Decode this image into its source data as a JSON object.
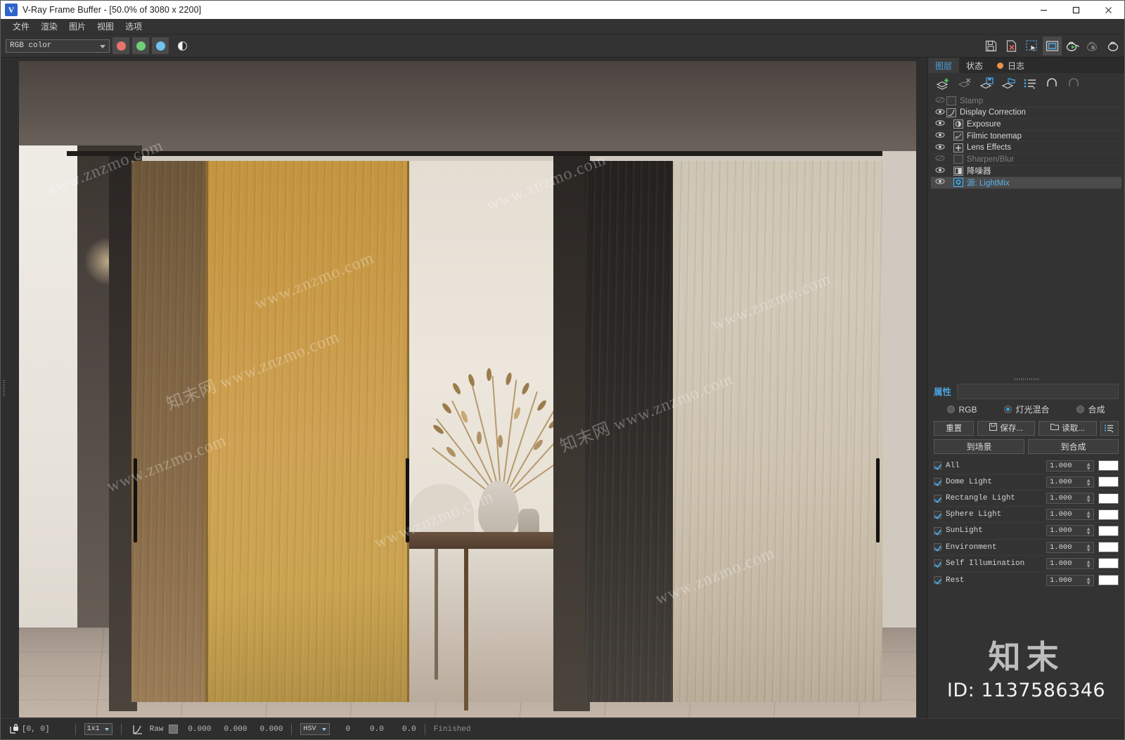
{
  "window": {
    "title": "V-Ray Frame Buffer - [50.0% of 3080 x 2200]",
    "app_icon": "vray-logo-icon",
    "minimize": "minimize-icon",
    "maximize": "maximize-icon",
    "close": "close-icon"
  },
  "menubar": {
    "items": [
      {
        "label": "文件"
      },
      {
        "label": "渲染"
      },
      {
        "label": "图片"
      },
      {
        "label": "视图"
      },
      {
        "label": "选项"
      }
    ]
  },
  "toolbar": {
    "channel_select": {
      "value": "RGB color",
      "placeholder": "RGB color"
    },
    "channels": [
      {
        "name": "red-channel-button",
        "color": "#e8736f"
      },
      {
        "name": "green-channel-button",
        "color": "#6fcf76"
      },
      {
        "name": "blue-channel-button",
        "color": "#6fc3ef"
      }
    ],
    "alpha_button": "alpha-channel-icon",
    "right_icons": [
      "save-image-icon",
      "save-image-as-icon",
      "region-render-icon",
      "fit-to-window-icon",
      "start-render-icon",
      "stop-render-icon",
      "render-last-icon"
    ]
  },
  "right_panel": {
    "tabs": [
      {
        "label": "图层",
        "selected": true,
        "name": "tab-layers"
      },
      {
        "label": "状态",
        "selected": false,
        "name": "tab-status"
      },
      {
        "label": "日志",
        "selected": false,
        "name": "tab-log",
        "dot": "#e8924a"
      }
    ],
    "layer_tools": [
      "add-layer-icon",
      "delete-layer-icon",
      "save-layers-icon",
      "load-layers-icon",
      "layer-presets-icon",
      "undo-icon",
      "redo-icon"
    ],
    "layers": [
      {
        "label": "Stamp",
        "visible": false,
        "disabled": true,
        "selected": false,
        "icon": "stamp-icon",
        "indent": 0
      },
      {
        "label": "Display Correction",
        "visible": true,
        "disabled": false,
        "selected": false,
        "icon": "curve-icon",
        "indent": 0
      },
      {
        "label": "Exposure",
        "visible": true,
        "disabled": false,
        "selected": false,
        "icon": "exposure-icon",
        "indent": 1
      },
      {
        "label": "Filmic tonemap",
        "visible": true,
        "disabled": false,
        "selected": false,
        "icon": "filmic-icon",
        "indent": 1
      },
      {
        "label": "Lens Effects",
        "visible": true,
        "disabled": false,
        "selected": false,
        "icon": "lens-effects-icon",
        "indent": 1
      },
      {
        "label": "Sharpen/Blur",
        "visible": false,
        "disabled": true,
        "selected": false,
        "icon": "sharpen-icon",
        "indent": 1
      },
      {
        "label": "降噪器",
        "visible": true,
        "disabled": false,
        "selected": false,
        "icon": "denoiser-icon",
        "indent": 1
      },
      {
        "label": "源: LightMix",
        "visible": true,
        "disabled": false,
        "selected": true,
        "icon": "lightmix-icon",
        "indent": 1
      }
    ],
    "properties": {
      "title": "属性",
      "modes": [
        {
          "label": "RGB",
          "selected": false,
          "name": "radio-rgb"
        },
        {
          "label": "灯光混合",
          "selected": true,
          "name": "radio-lightmix"
        },
        {
          "label": "合成",
          "selected": false,
          "name": "radio-composite"
        }
      ],
      "buttons": {
        "reset": "重置",
        "save": "保存...",
        "load": "读取...",
        "menu_icon": "list-menu-icon"
      },
      "buttons2": {
        "to_scene": "到场景",
        "to_composite": "到合成"
      },
      "lights": [
        {
          "name": "All",
          "enabled": true,
          "value": "1.000",
          "color": "#ffffff"
        },
        {
          "name": "Dome Light",
          "enabled": true,
          "value": "1.000",
          "color": "#ffffff"
        },
        {
          "name": "Rectangle Light",
          "enabled": true,
          "value": "1.000",
          "color": "#ffffff"
        },
        {
          "name": "Sphere Light",
          "enabled": true,
          "value": "1.000",
          "color": "#ffffff"
        },
        {
          "name": "SunLight",
          "enabled": true,
          "value": "1.000",
          "color": "#ffffff"
        },
        {
          "name": "Environment",
          "enabled": true,
          "value": "1.000",
          "color": "#ffffff"
        },
        {
          "name": "Self Illumination",
          "enabled": true,
          "value": "1.000",
          "color": "#ffffff"
        },
        {
          "name": "Rest",
          "enabled": true,
          "value": "1.000",
          "color": "#ffffff"
        }
      ]
    },
    "watermark": {
      "logo": "知末",
      "id": "ID: 1137586346"
    }
  },
  "statusbar": {
    "lock_icon": "pixel-lock-icon",
    "coords": "[0,  0]",
    "sample_size": "1x1",
    "curve_icon": "color-curve-icon",
    "raw_label": "Raw",
    "swatch_color": "#6e6e6e",
    "values": [
      "0.000",
      "0.000",
      "0.000"
    ],
    "color_mode": "HSV",
    "hsv_values": [
      "0",
      "0.0",
      "0.0"
    ],
    "render_status": "Finished"
  },
  "canvas": {
    "watermarks": [
      "www.znzmo.com",
      "知末网 www.znzmo.com"
    ],
    "scene_description": "Interior render: sliding wood doors, console table with dried flowers in vase"
  }
}
